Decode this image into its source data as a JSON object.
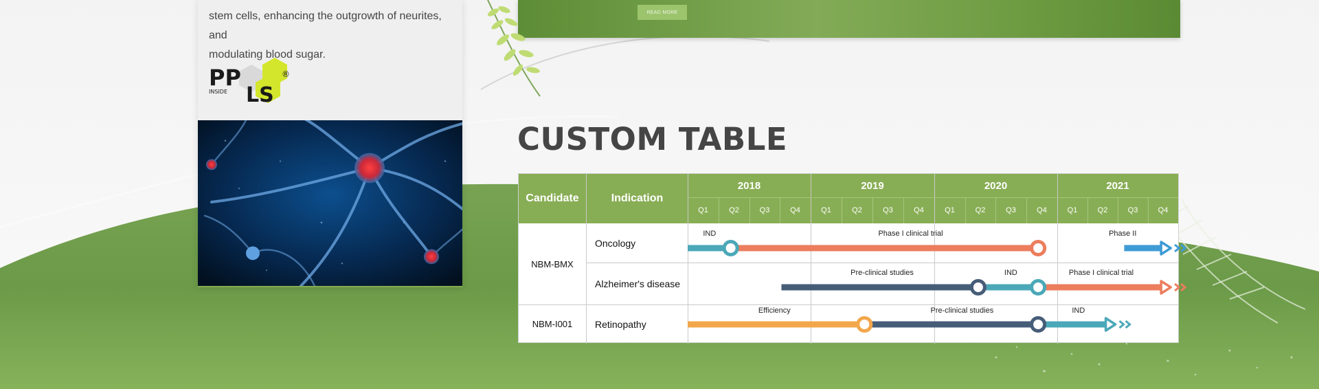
{
  "card": {
    "description_line1": "stem cells, enhancing the outgrowth of neurites, and",
    "description_line2": "modulating blood sugar.",
    "logo": {
      "letters_top": "PP",
      "letters_bottom": "LS",
      "registered": "®",
      "tag": "INSIDE"
    },
    "image": "neuron-cells-image"
  },
  "banner": {
    "read_more_label": "READ MORE"
  },
  "section": {
    "title": "CUSTOM TABLE"
  },
  "table": {
    "header": {
      "candidate": "Candidate",
      "indication": "Indication",
      "years": [
        "2018",
        "2019",
        "2020",
        "2021"
      ],
      "quarters": [
        "Q1",
        "Q2",
        "Q3",
        "Q4",
        "Q1",
        "Q2",
        "Q3",
        "Q4",
        "Q1",
        "Q2",
        "Q3",
        "Q4",
        "Q1",
        "Q2",
        "Q3",
        "Q4"
      ]
    },
    "candidates": [
      {
        "name": "NBM-BMX",
        "indications": [
          "Oncology",
          "Alzheimer's disease"
        ]
      },
      {
        "name": "NBM-I001",
        "indications": [
          "Retinopathy"
        ]
      }
    ],
    "colors": {
      "header": "#88ae55",
      "teal": "#4ba8b8",
      "orange_red": "#ec7d5d",
      "navy": "#465d78",
      "orange": "#f2a74b",
      "blue": "#3e9bd5"
    },
    "timelines": [
      {
        "row": 0,
        "labels": [
          {
            "text": "IND",
            "at": 0.5
          },
          {
            "text": "Phase I clinical trial",
            "at": 6.2
          },
          {
            "text": "Phase II",
            "at": 13.7
          }
        ]
      },
      {
        "row": 1,
        "labels": [
          {
            "text": "Pre-clinical studies",
            "at": 5.3
          },
          {
            "text": "IND",
            "at": 10.3
          },
          {
            "text": "Phase I clinical trial",
            "at": 12.4
          }
        ]
      },
      {
        "row": 2,
        "labels": [
          {
            "text": "Efficiency",
            "at": 2.3
          },
          {
            "text": "Pre-clinical studies",
            "at": 7.9
          },
          {
            "text": "IND",
            "at": 12.5
          }
        ]
      }
    ]
  }
}
